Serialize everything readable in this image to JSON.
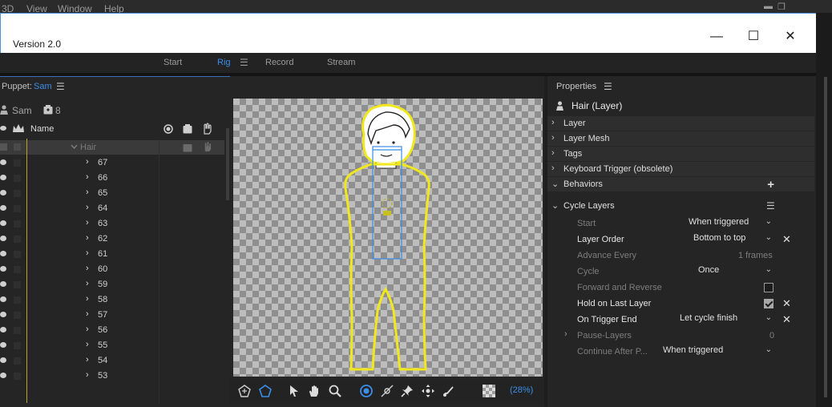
{
  "menubar": {
    "items": [
      "3D",
      "View",
      "Window",
      "Help"
    ],
    "minimize_glyph": "▬",
    "restore_glyph": "❐"
  },
  "window": {
    "title": "Version 2.0",
    "minimize_glyph": "—",
    "maximize_glyph": "☐",
    "close_glyph": "✕"
  },
  "workspace": {
    "tabs": [
      {
        "label": "Start",
        "active": false
      },
      {
        "label": "Rig",
        "active": true
      },
      {
        "label": "Record",
        "active": false
      },
      {
        "label": "Stream",
        "active": false
      }
    ],
    "menu_glyph": "☰"
  },
  "puppet_panel": {
    "header_label": "Puppet:",
    "puppet_name": "Sam",
    "menu_glyph": "☰",
    "info_name": "Sam",
    "layer_count": "8",
    "column_name": "Name",
    "selected_layer": "Hair",
    "layers": [
      "67",
      "66",
      "65",
      "64",
      "63",
      "62",
      "61",
      "60",
      "59",
      "58",
      "57",
      "56",
      "55",
      "54",
      "53"
    ],
    "chevron_glyph": "›"
  },
  "canvas": {
    "zoom": "(28%)"
  },
  "properties": {
    "title": "Properties",
    "menu_glyph": "☰",
    "object": "Hair (Layer)",
    "sections": [
      "Layer",
      "Layer Mesh",
      "Tags",
      "Keyboard Trigger (obsolete)"
    ],
    "behaviors_label": "Behaviors",
    "add_glyph": "+",
    "behavior": {
      "name": "Cycle Layers",
      "rows": {
        "start": {
          "label": "Start",
          "value": "When triggered"
        },
        "layer_order": {
          "label": "Layer Order",
          "value": "Bottom to top"
        },
        "advance_every": {
          "label": "Advance Every",
          "value": "1 frames"
        },
        "cycle": {
          "label": "Cycle",
          "value": "Once"
        },
        "forward_reverse": {
          "label": "Forward and Reverse",
          "checked": false
        },
        "hold_last": {
          "label": "Hold on Last Layer",
          "checked": true
        },
        "on_trigger_end": {
          "label": "On Trigger End",
          "value": "Let cycle finish"
        },
        "pause_layers": {
          "label": "Pause-Layers",
          "value": "0"
        },
        "continue_after": {
          "label": "Continue After P...",
          "value": "When triggered"
        }
      }
    },
    "remove_glyph": "✕",
    "caret_glyph": "⌄"
  },
  "colors": {
    "accent_blue": "#3b8ee8",
    "rig_outline": "#f0e81c",
    "selection_box": "#3b8ee8"
  }
}
